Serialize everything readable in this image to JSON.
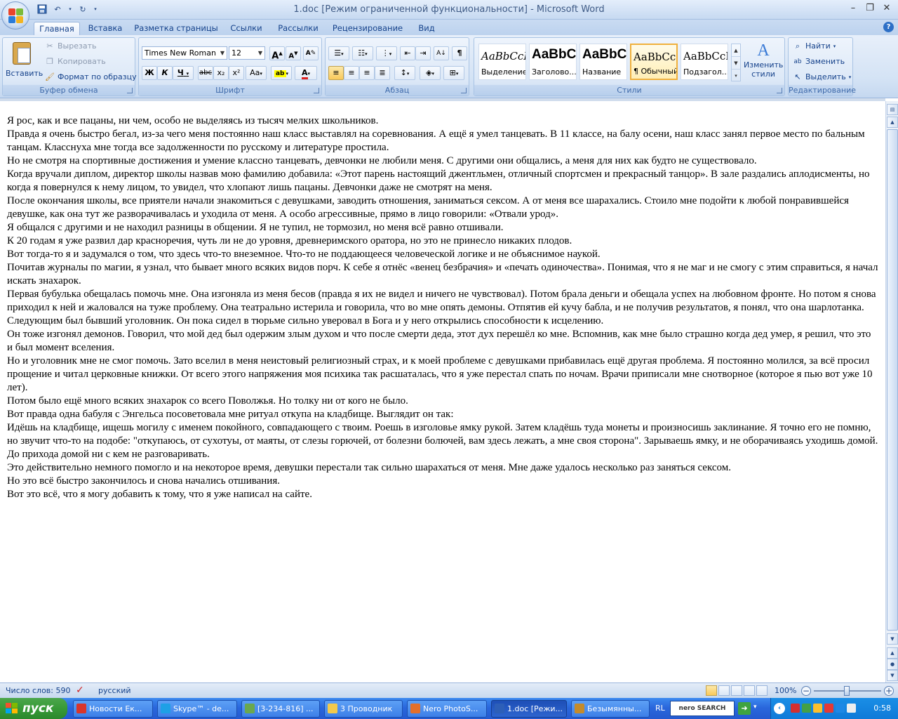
{
  "window": {
    "title": "1.doc [Режим ограниченной функциональности] - Microsoft Word"
  },
  "tabs": [
    "Главная",
    "Вставка",
    "Разметка страницы",
    "Ссылки",
    "Рассылки",
    "Рецензирование",
    "Вид"
  ],
  "clipboard": {
    "paste": "Вставить",
    "cut": "Вырезать",
    "copy": "Копировать",
    "format_painter": "Формат по образцу",
    "label": "Буфер обмена"
  },
  "font": {
    "name": "Times New Roman",
    "size": "12",
    "label": "Шрифт",
    "bold": "Ж",
    "italic": "К",
    "underline": "Ч",
    "strike": "abc",
    "subscript": "x₂",
    "superscript": "x²",
    "change_case": "Aa",
    "grow": "A",
    "shrink": "A"
  },
  "paragraph": {
    "label": "Абзац"
  },
  "styles": {
    "label": "Стили",
    "items": [
      {
        "sample": "AaBbCcI",
        "name": "Выделение"
      },
      {
        "sample": "AaBbC",
        "name": "Заголово..."
      },
      {
        "sample": "AaBbC",
        "name": "Название"
      },
      {
        "sample": "AaBbCcI",
        "name": "¶ Обычный"
      },
      {
        "sample": "AaBbCcI",
        "name": "Подзагол..."
      }
    ],
    "change": "Изменить стили"
  },
  "editing": {
    "label": "Редактирование",
    "find": "Найти",
    "replace": "Заменить",
    "select": "Выделить"
  },
  "document": {
    "paragraphs": [
      "Я рос, как и все пацаны, ни чем, особо не выделяясь из тысяч мелких школьников.",
      "Правда я очень быстро бегал, из-за чего меня постоянно наш класс выставлял на соревнования. А ещё я умел танцевать. В 11 классе, на балу осени, наш класс занял первое место по бальным танцам. Класснуха мне тогда все задолженности по русскому и литературе простила.",
      "Но не смотря на спортивные достижения и умение классно танцевать, девчонки не любили меня. С другими они общались, а меня для них как будто не существовало.",
      "Когда вручали диплом, директор школы назвав мою фамилию добавила: «Этот парень настоящий джентльмен, отличный спортсмен и прекрасный танцор». В зале раздались аплодисменты, но когда я повернулся к нему лицом, то увидел, что хлопают лишь пацаны. Девчонки даже не смотрят на меня.",
      "После окончания школы, все приятели начали знакомиться с девушками, заводить отношения, заниматься сексом. А от меня все шарахались. Стоило мне подойти к любой понравившейся девушке, как она тут же разворачивалась и уходила от меня. А особо агрессивные, прямо в лицо говорили: «Отвали урод».",
      "Я общался с другими и не находил разницы в общении. Я не тупил, не тормозил, но меня всё равно отшивали.",
      "К 20 годам я уже развил дар красноречия, чуть ли не до уровня, древнеримского оратора, но это не принесло никаких плодов.",
      "Вот тогда-то я и задумался о том, что здесь что-то внеземное. Что-то не поддающееся человеческой логике и не объяснимое наукой.",
      "Почитав журналы по магии, я узнал, что бывает много всяких видов порч. К себе я отнёс «венец безбрачия» и «печать одиночества». Понимая, что я не маг и не смогу с этим справиться, я начал искать знахарок.",
      "Первая бубулька обещалась помочь мне. Она изгоняла из меня бесов (правда я их не видел и ничего не чувствовал). Потом брала деньги и обещала успех на любовном фронте. Но потом я снова приходил к ней и жаловался на туже проблему. Она театрально истерила и говорила, что во мне опять демоны. Отпятив ей кучу бабла, и не получив результатов, я понял, что она шарлотанка.",
      "Следующим был бывший уголовник. Он пока сидел в тюрьме сильно уверовал в Бога и у него открылись способности к исцелению.",
      "Он тоже изгонял демонов. Говорил, что мой дед был одержим злым духом и что после смерти деда, этот дух перешёл ко мне. Вспомнив, как мне было страшно когда дед умер, я решил, что это и был момент вселения.",
      "Но и уголовник мне не смог помочь. Зато вселил в меня неистовый религиозный страх, и к моей проблеме с девушками прибавилась ещё другая проблема. Я постоянно молился, за всё просил прощение и читал церковные книжки. От всего этого напряжения моя психика так расшаталась, что я уже перестал спать по ночам. Врачи приписали мне снотворное (которое я пью вот уже 10 лет).",
      "Потом было ещё много всяких знахарок со всего Поволжья. Но толку ни от кого не было.",
      "Вот правда одна бабуля с Энгельса посоветовала мне ритуал откупа на кладбище. Выглядит он так:",
      "Идёшь на кладбище, ищешь могилу с именем покойного, совпадающего с твоим. Роешь в изголовье ямку рукой. Затем кладёшь туда монеты и произносишь заклинание. Я точно его не помню, но звучит что-то на подобе: \"откупаюсь, от сухотуы, от маяты, от слезы горючей, от болезни болючей, вам здесь лежать, а мне своя сторона\". Зарываешь ямку, и не оборачиваясь уходишь домой. До прихода домой ни с кем не разговаривать.",
      "Это действительно немного помогло и на некоторое время, девушки перестали так сильно шарахаться от меня. Мне даже удалось несколько раз заняться сексом.",
      "Но это всё быстро закончилось и снова начались отшивания.",
      "Вот это всё, что я могу добавить к тому, что я уже написал на сайте."
    ]
  },
  "status": {
    "word_count": "Число слов: 590",
    "language": "русский",
    "zoom": "100%"
  },
  "taskbar": {
    "start": "пуск",
    "tasks": [
      {
        "label": "Новости Ек...",
        "color": "#d9352b"
      },
      {
        "label": "Skype™ - de...",
        "color": "#1ea0e6"
      },
      {
        "label": "[3-234-816] ...",
        "color": "#6aa84f"
      },
      {
        "label": "3 Проводник",
        "color": "#f2c94c"
      },
      {
        "label": "Nero PhotoS...",
        "color": "#e36f2a"
      },
      {
        "label": "1.doc [Режи...",
        "color": "#2d5fb8"
      },
      {
        "label": "Безымянны...",
        "color": "#c58b2a"
      }
    ],
    "lang": "RL",
    "nero_search": "nero SEARCH",
    "clock": "0:58"
  },
  "colors": {
    "accent": "#15428b",
    "spell_error": "#e02020",
    "grammar_error": "#1f8f1f",
    "taskbar": "#245ad0",
    "start": "#379a37"
  }
}
